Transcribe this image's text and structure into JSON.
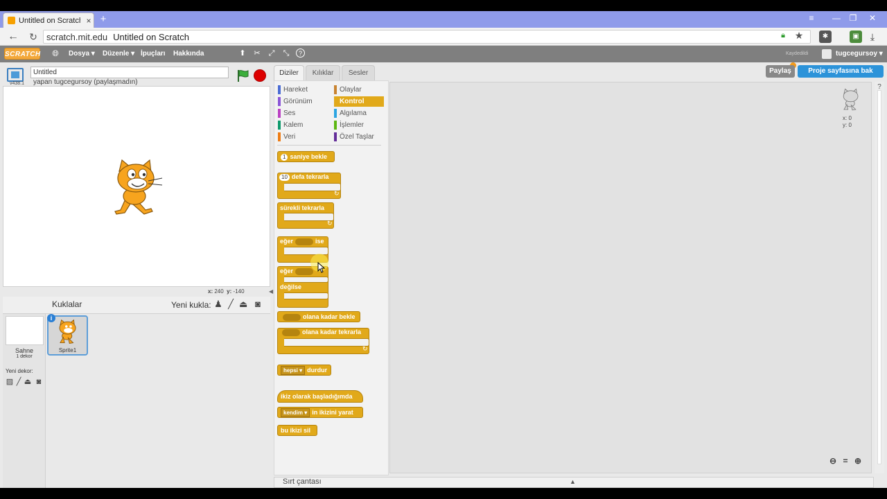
{
  "browser": {
    "tab_title": "Untitled on Scratch",
    "tab_close": "×",
    "new_tab": "+",
    "url_domain": "scratch.mit.edu",
    "url_page_title": "Untitled on Scratch",
    "window_controls": [
      "≡",
      "—",
      "❐",
      "✕"
    ]
  },
  "menu": {
    "logo": "SCRATCH",
    "items": [
      "Dosya ▾",
      "Düzenle ▾",
      "İpuçları",
      "Hakkında"
    ],
    "saved_label": "Kaydedildi",
    "username": "tugcegursoy ▾"
  },
  "stage": {
    "version": "v438.1",
    "project_title": "Untitled",
    "byline": "yapan tugcegursoy (paylaşmadın)",
    "coords_x_label": "x:",
    "coords_x": "240",
    "coords_y_label": "y:",
    "coords_y": "-140"
  },
  "sprites": {
    "sahne": "Sahne",
    "dekor_count": "1 dekor",
    "yeni_dekor": "Yeni dekor:",
    "kuklalar": "Kuklalar",
    "yeni_kukla": "Yeni kukla:",
    "sprite1_name": "Sprite1",
    "sprite1_info": "i"
  },
  "palette": {
    "tabs": [
      "Diziler",
      "Kılıklar",
      "Sesler"
    ],
    "categories_left": [
      {
        "label": "Hareket",
        "color": "#4a6cd4"
      },
      {
        "label": "Görünüm",
        "color": "#8a55d7"
      },
      {
        "label": "Ses",
        "color": "#bb42c3"
      },
      {
        "label": "Kalem",
        "color": "#0e9a6c"
      },
      {
        "label": "Veri",
        "color": "#ee7d16"
      }
    ],
    "categories_right": [
      {
        "label": "Olaylar",
        "color": "#c88330"
      },
      {
        "label": "Kontrol",
        "color": "#e1a91a"
      },
      {
        "label": "Algılama",
        "color": "#2ca5e2"
      },
      {
        "label": "İşlemler",
        "color": "#5cb712"
      },
      {
        "label": "Özel Taşlar",
        "color": "#632d99"
      }
    ],
    "blocks": {
      "wait_num": "1",
      "wait": "saniye bekle",
      "repeat_num": "10",
      "repeat": "defa tekrarla",
      "forever": "sürekli tekrarla",
      "if": "eğer",
      "then": "ise",
      "if2": "eğer",
      "else": "değilse",
      "wait_until": "olana kadar bekle",
      "repeat_until": "olana kadar tekrarla",
      "stop_dd": "hepsi ▾",
      "stop": "durdur",
      "clone_start": "ikiz olarak başladığımda",
      "create_dd": "kendim ▾",
      "create_clone": "in ikizini yarat",
      "delete_clone": "bu ikizi sil"
    }
  },
  "script_area": {
    "x_label": "x: 0",
    "y_label": "y: 0"
  },
  "header_buttons": {
    "share": "Paylaş",
    "see_project": "Proje sayfasına bak"
  },
  "backpack": {
    "label": "Sırt çantası",
    "arrow": "▲"
  }
}
